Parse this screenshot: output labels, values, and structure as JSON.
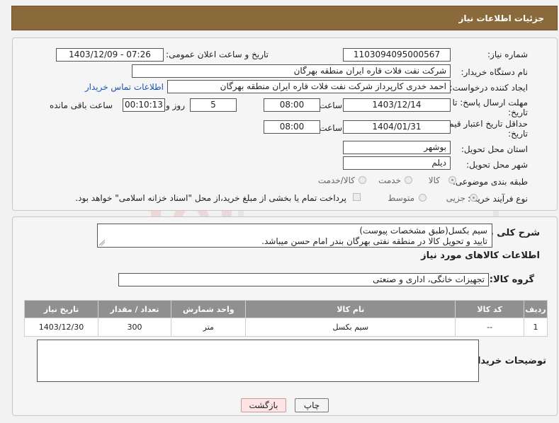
{
  "header": {
    "title": "جزئیات اطلاعات نیاز"
  },
  "form": {
    "need_number": {
      "label": "شماره نیاز:",
      "value": "1103094095000567"
    },
    "announce": {
      "label": "تاریخ و ساعت اعلان عمومی:",
      "value": "1403/12/09 - 07:26"
    },
    "buyer_org": {
      "label": "نام دستگاه خریدار:",
      "value": "شرکت نفت فلات قاره ایران منطقه بهرگان"
    },
    "creator": {
      "label": "ایجاد کننده درخواست:",
      "value": "احمد خدری کارپرداز شرکت نفت فلات قاره ایران منطقه بهرگان",
      "contact_link": "اطلاعات تماس خریدار"
    },
    "deadline": {
      "label_line1": "مهلت ارسال پاسخ: تا",
      "label_line2": "تاریخ:",
      "date": "1403/12/14",
      "time_label": "ساعت",
      "time": "08:00",
      "days": "5",
      "days_label": "روز و",
      "remaining": "00:10:13",
      "remaining_label": "ساعت باقی مانده"
    },
    "validity": {
      "label_line1": "حداقل تاریخ اعتبار قیمت: تا",
      "label_line2": "تاریخ:",
      "date": "1404/01/31",
      "time_label": "ساعت",
      "time": "08:00"
    },
    "province": {
      "label": "استان محل تحویل:",
      "value": "بوشهر"
    },
    "city": {
      "label": "شهر محل تحویل:",
      "value": "دیلم"
    },
    "category": {
      "label": "طبقه بندی موضوعی:",
      "options": [
        "کالا",
        "خدمت",
        "کالا/خدمت"
      ]
    },
    "process": {
      "label": "نوع فرآیند خرید :",
      "options": [
        "جزیی",
        "متوسط"
      ],
      "payment_note": "پرداخت تمام یا بخشی از مبلغ خرید،از محل \"اسناد خزانه اسلامی\" خواهد بود."
    }
  },
  "summary": {
    "label": "شرح کلی نیاز:",
    "line1": "سیم بکسل(طبق مشخصات پیوست)",
    "line2": "تایید و تحویل کالا در منطقه نفتی بهرگان  بندر امام حسن میباشد.",
    "items_heading": "اطلاعات کالاهای مورد نیاز",
    "group_label": "گروه کالا:",
    "group_value": "تجهیزات خانگی، اداری و صنعتی"
  },
  "table": {
    "headers": [
      "ردیف",
      "کد کالا",
      "نام کالا",
      "واحد شمارش",
      "تعداد / مقدار",
      "تاریخ نیاز"
    ],
    "rows": [
      [
        "1",
        "--",
        "سیم بکسل",
        "متر",
        "300",
        "1403/12/30"
      ]
    ]
  },
  "buyer_notes": {
    "label": "توضیحات خریدار:",
    "value": ""
  },
  "buttons": {
    "print": "چاپ",
    "back": "بازگشت"
  },
  "colors": {
    "header_bg": "#8a6a3a",
    "table_header_bg": "#909090",
    "link": "#1a55b5"
  }
}
